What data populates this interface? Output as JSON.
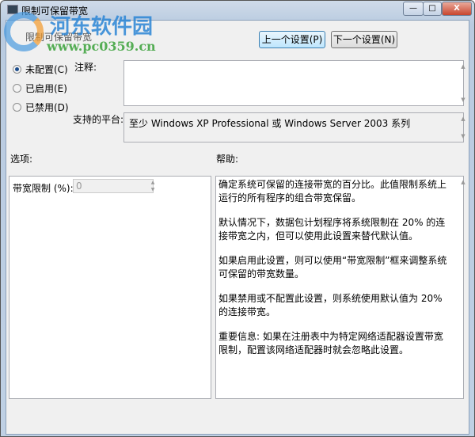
{
  "window": {
    "title": "限制可保留带宽",
    "minimize": "—",
    "maximize": "□",
    "close": "X"
  },
  "header": {
    "policy_name": "限制可保留带宽",
    "prev_button": "上一个设置(P)",
    "next_button": "下一个设置(N)"
  },
  "state": {
    "options": [
      "未配置(C)",
      "已启用(E)",
      "已禁用(D)"
    ],
    "selected": 0
  },
  "comment": {
    "label": "注释:",
    "value": ""
  },
  "platform": {
    "label": "支持的平台:",
    "value": "至少 Windows XP Professional 或 Windows Server 2003 系列"
  },
  "options_panel": {
    "heading": "选项:",
    "field_label": "带宽限制 (%):",
    "field_value": "0"
  },
  "help_panel": {
    "heading": "帮助:",
    "paragraphs": [
      "确定系统可保留的连接带宽的百分比。此值限制系统上运行的所有程序的组合带宽保留。",
      "默认情况下，数据包计划程序将系统限制在 20% 的连接带宽之内，但可以使用此设置来替代默认值。",
      "如果启用此设置，则可以使用“带宽限制”框来调整系统可保留的带宽数量。",
      "如果禁用或不配置此设置，则系统使用默认值为 20% 的连接带宽。",
      "重要信息: 如果在注册表中为特定网络适配器设置带宽限制，配置该网络适配器时就会忽略此设置。"
    ]
  },
  "watermark": {
    "site": "河东软件园",
    "url": "www.pc0359.cn"
  }
}
